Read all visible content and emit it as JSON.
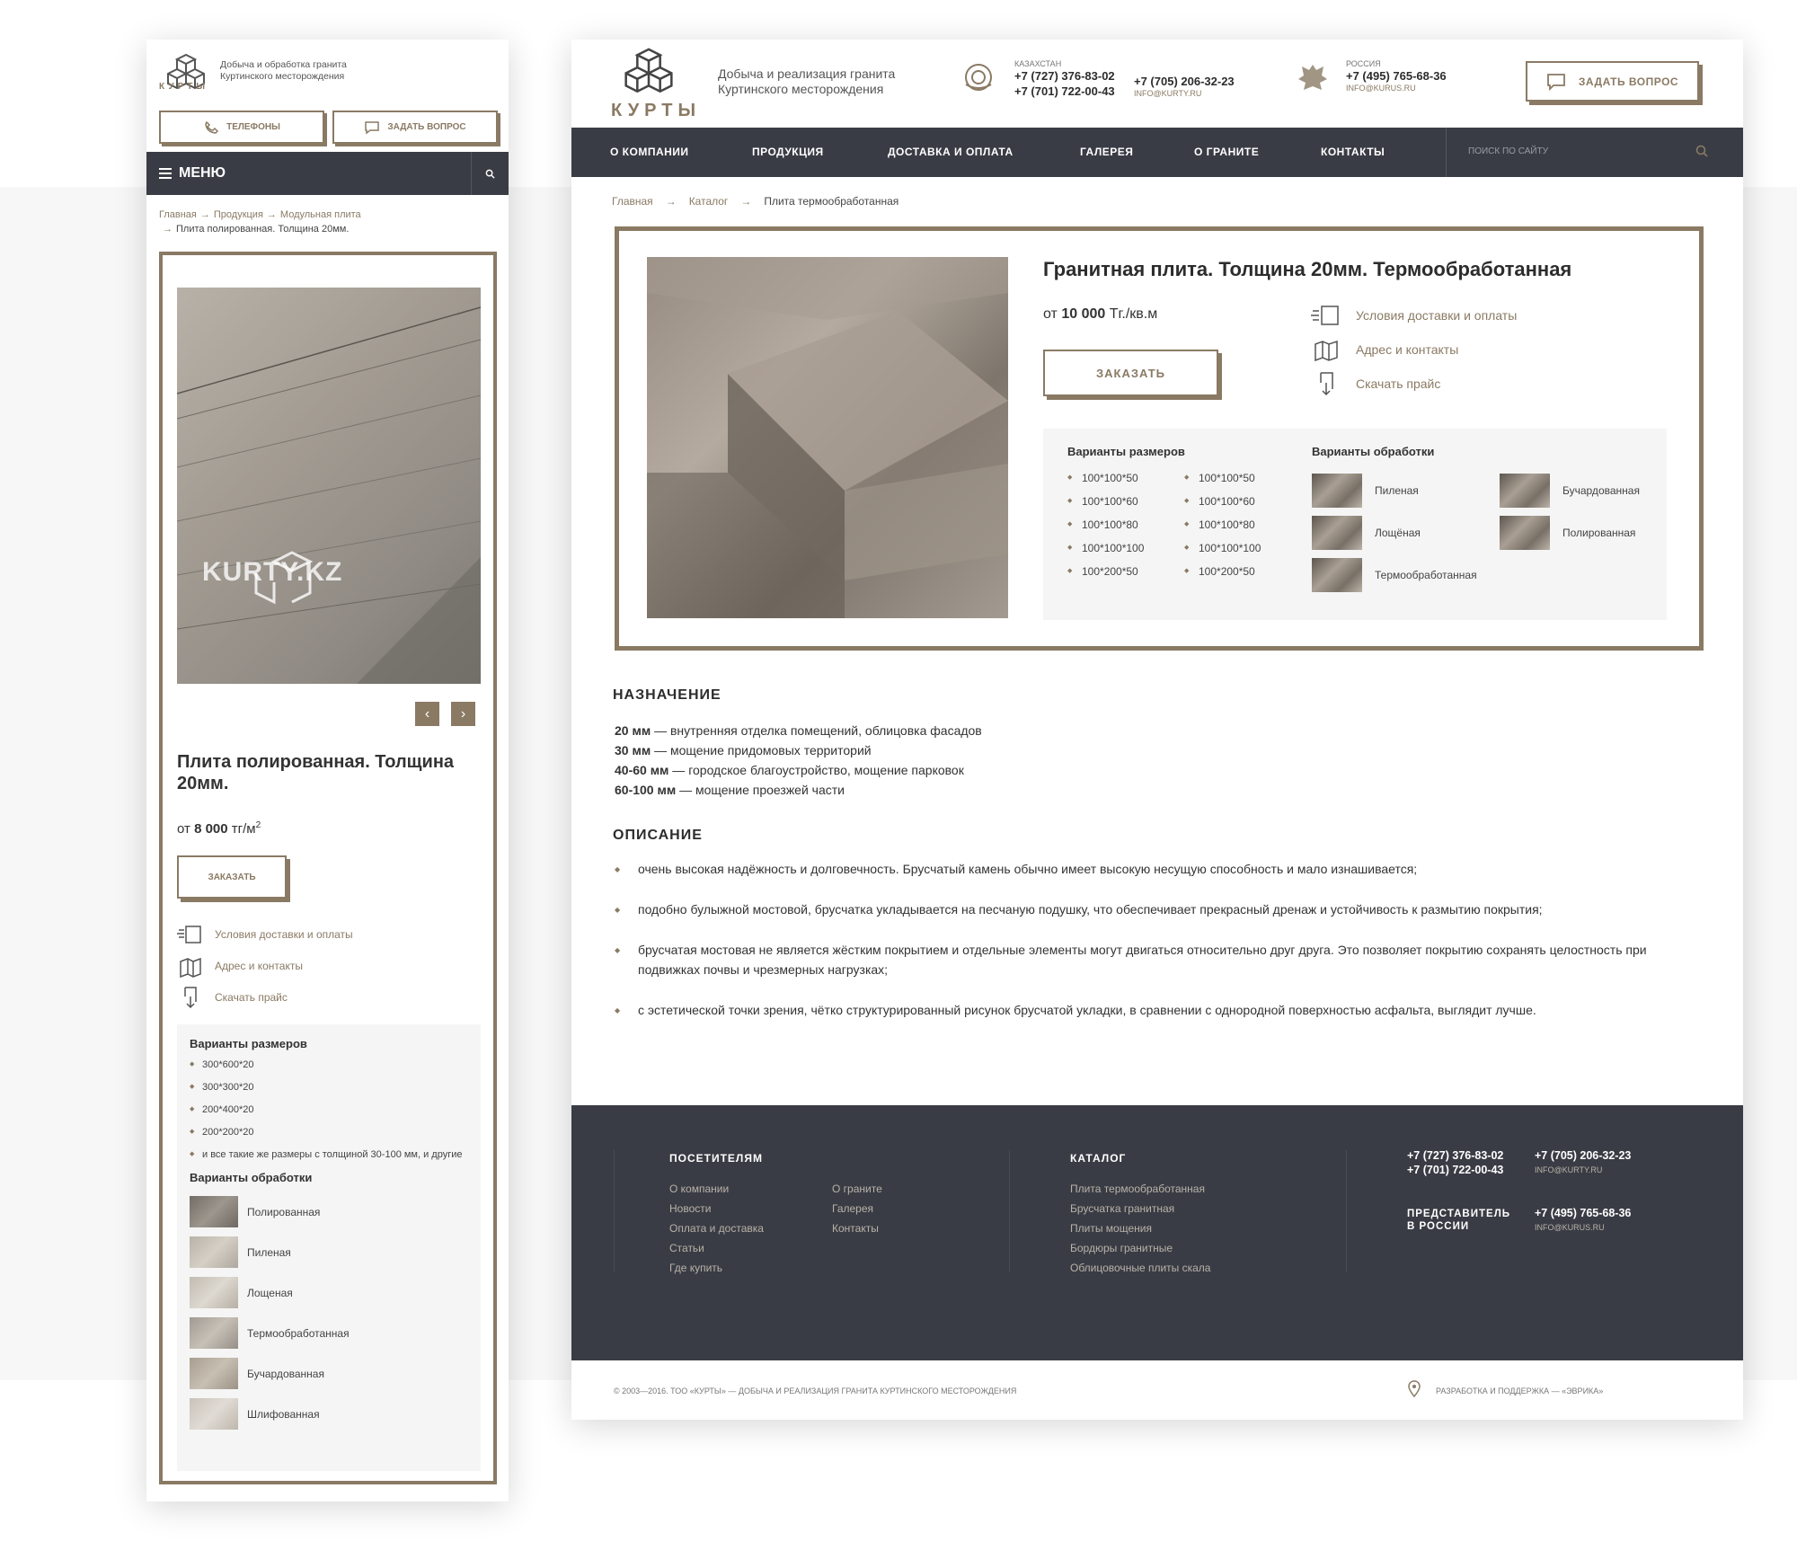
{
  "brand": {
    "logo_text": "КУРТЫ",
    "accent": "#8a7a64",
    "dark": "#3a3c45"
  },
  "mobile": {
    "logo_text": "КУРТЫ",
    "tagline_line1": "Добыча и обработка гранита",
    "tagline_line2": "Куртинского месторождения",
    "phones_btn": "Телефоны",
    "ask_btn": "Задать вопрос",
    "menu_label": "МЕНЮ",
    "crumbs": [
      "Главная",
      "Продукция",
      "Модульная плита",
      "Плита полированная. Толщина 20мм."
    ],
    "watermark": "KURTY.KZ",
    "title": "Плита полированная. Толщина 20мм.",
    "price_prefix": "от",
    "price_value": "8 000",
    "price_unit": "тг/м",
    "price_sup": "2",
    "order_btn": "Заказать",
    "links": [
      "Условия доставки и оплаты",
      "Адрес и контакты",
      "Скачать прайс"
    ],
    "sizes_title": "Варианты размеров",
    "sizes": [
      "300*600*20",
      "300*300*20",
      "200*400*20",
      "200*200*20",
      "и все такие же размеры с толщиной 30-100 мм, и другие"
    ],
    "processing_title": "Варианты обработки",
    "processing": [
      "Полированная",
      "Пиленая",
      "Лощеная",
      "Термообработанная",
      "Бучардованная",
      "Шлифованная"
    ]
  },
  "desktop": {
    "tagline_line1": "Добыча и реализация гранита",
    "tagline_line2": "Куртинского месторождения",
    "kz": {
      "country": "Казахстан",
      "phone1": "+7 (727) 376-83-02",
      "phone2": "+7 (701) 722-00-43",
      "phone3": "+7 (705) 206-32-23",
      "email": "info@kurty.ru"
    },
    "ru": {
      "country": "Россия",
      "phone1": "+7 (495) 765-68-36",
      "email": "info@kurus.ru"
    },
    "ask_btn": "Задать вопрос",
    "nav": [
      "О компании",
      "Продукция",
      "Доставка и оплата",
      "Галерея",
      "О граните",
      "Контакты"
    ],
    "search_placeholder": "Поиск по сайту",
    "crumbs": [
      "Главная",
      "Каталог",
      "Плита термообработанная"
    ],
    "title": "Гранитная плита. Толщина 20мм. Термообработанная",
    "price_prefix": "от",
    "price_value": "10 000",
    "price_unit": "Тг./кв.м",
    "order_btn": "Заказать",
    "links": [
      "Условия доставки и оплаты",
      "Адрес и контакты",
      "Скачать прайс"
    ],
    "sizes_title": "Варианты размеров",
    "sizes_col1": [
      "100*100*50",
      "100*100*60",
      "100*100*80",
      "100*100*100",
      "100*200*50"
    ],
    "sizes_col2": [
      "100*100*50",
      "100*100*60",
      "100*100*80",
      "100*100*100",
      "100*200*50"
    ],
    "processing_title": "Варианты обработки",
    "processing": [
      "Пиленая",
      "Бучардованная",
      "Лощёная",
      "Полированная",
      "Термообработанная"
    ],
    "purpose_title": "Назначение",
    "purpose": [
      {
        "bold": "20 мм",
        "text": " — внутренняя отделка помещений, облицовка фасадов"
      },
      {
        "bold": "30 мм",
        "text": " — мощение придомовых территорий"
      },
      {
        "bold": "40-60 мм",
        "text": " — городское благоустройство, мощение парковок"
      },
      {
        "bold": "60-100 мм",
        "text": " — мощение проезжей части"
      }
    ],
    "desc_title": "Описание",
    "desc": [
      "очень высокая надёжность и долговечность. Брусчатый камень обычно имеет высокую несущую способность и мало изнашивается;",
      "подобно булыжной мостовой, брусчатка укладывается на песчаную подушку, что обеспечивает прекрасный дренаж и устойчивость к размытию покрытия;",
      "брусчатая мостовая не является жёстким покрытием и отдельные элементы могут двигаться относительно друг друга. Это позволяет покрытию сохранять целостность при подвижках почвы и чрезмерных нагрузках;",
      "с эстетической точки зрения, чётко структурированный рисунок брусчатой укладки, в сравнении с однородной поверхностью асфальта, выглядит лучше."
    ],
    "footer": {
      "visitors_title": "Посетителям",
      "visitors_col1": [
        "О компании",
        "Новости",
        "Оплата и доставка",
        "Статьи",
        "Где купить"
      ],
      "visitors_col2": [
        "О граните",
        "Галерея",
        "Контакты"
      ],
      "catalog_title": "Каталог",
      "catalog": [
        "Плита термообработанная",
        "Брусчатка гранитная",
        "Плиты мощения",
        "Бордюры гранитные",
        "Облицовочные плиты скала"
      ],
      "phone1": "+7 (727) 376-83-02",
      "phone2": "+7 (701) 722-00-43",
      "phone3": "+7 (705) 206-32-23",
      "email1": "info@kurty.ru",
      "rep_line1": "Представитель",
      "rep_line2": "в России",
      "rep_phone": "+7 (495) 765-68-36",
      "rep_email": "info@kurus.ru",
      "copyright": "© 2003—2016. ТОО «Курты» — добыча и реализация гранита Куртинского месторождения",
      "dev": "Разработка и поддержка — «Эврика»"
    }
  }
}
